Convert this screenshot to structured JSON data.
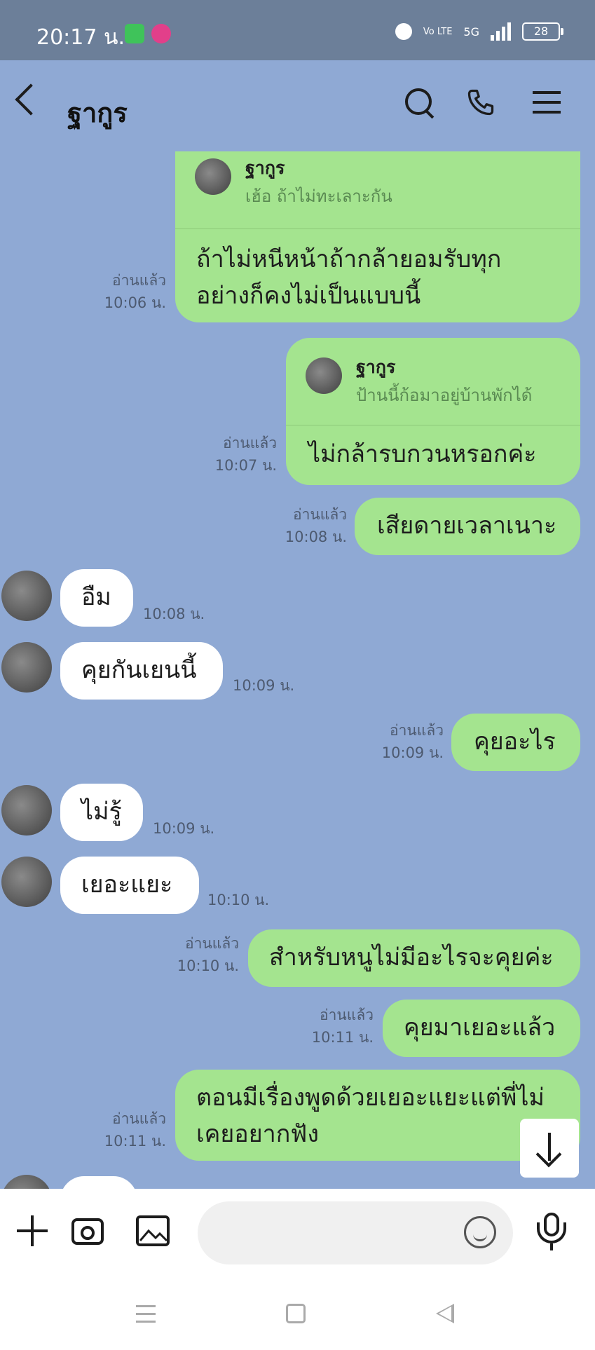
{
  "status_bar": {
    "time": "20:17 น.",
    "volte": "Vo LTE",
    "network": "5G",
    "battery": "28"
  },
  "header": {
    "contact_name": "ฐากูร"
  },
  "messages": [
    {
      "side": "out",
      "reply_to": {
        "name": "ฐากูร",
        "preview": "เฮ้อ ถ้าไม่ทะเลาะกัน"
      },
      "text_lines": [
        "ถ้าไม่หนีหน้าถ้ากล้ายอมรับทุก",
        "อย่างก็คงไม่เป็นแบบนี้"
      ],
      "read": "อ่านแล้ว",
      "time": "10:06 น."
    },
    {
      "side": "out",
      "reply_to": {
        "name": "ฐากูร",
        "preview": "ป้านนี้ก้อมาอยู่บ้านพักได้"
      },
      "text_lines": [
        "ไม่กล้ารบกวนหรอกค่ะ"
      ],
      "read": "อ่านแล้ว",
      "time": "10:07 น."
    },
    {
      "side": "out",
      "text_lines": [
        "เสียดายเวลาเนาะ"
      ],
      "read": "อ่านแล้ว",
      "time": "10:08 น."
    },
    {
      "side": "in",
      "text_lines": [
        "อืม"
      ],
      "time": "10:08 น."
    },
    {
      "side": "in",
      "text_lines": [
        "คุยกันเยนนี้"
      ],
      "time": "10:09 น."
    },
    {
      "side": "out",
      "text_lines": [
        "คุยอะไร"
      ],
      "read": "อ่านแล้ว",
      "time": "10:09 น."
    },
    {
      "side": "in",
      "text_lines": [
        "ไม่รู้"
      ],
      "time": "10:09 น."
    },
    {
      "side": "in",
      "text_lines": [
        "เยอะแยะ"
      ],
      "time": "10:10 น."
    },
    {
      "side": "out",
      "text_lines": [
        "สำหรับหนูไม่มีอะไรจะคุยค่ะ"
      ],
      "read": "อ่านแล้ว",
      "time": "10:10 น."
    },
    {
      "side": "out",
      "text_lines": [
        "คุยมาเยอะแล้ว"
      ],
      "read": "อ่านแล้ว",
      "time": "10:11 น."
    },
    {
      "side": "out",
      "text_lines": [
        "ตอนมีเรื่องพูดด้วยเยอะแยะแต่พี่ไม่",
        "เคยอยากฟัง"
      ],
      "read": "อ่านแล้ว",
      "time": "10:11 น."
    }
  ],
  "input": {
    "value": "",
    "placeholder": ""
  },
  "icons": {
    "back": "chevron-left-icon",
    "search": "search-icon",
    "call": "phone-icon",
    "menu": "hamburger-menu-icon",
    "add": "plus-icon",
    "camera": "camera-icon",
    "gallery": "image-icon",
    "emoji": "emoji-icon",
    "voice": "microphone-icon",
    "scroll_down": "arrow-down-icon"
  },
  "colors": {
    "chat_background": "#8fa9d4",
    "outgoing_bubble": "#a4e48f",
    "incoming_bubble": "#ffffff",
    "status_bar": "#6c7f99"
  }
}
